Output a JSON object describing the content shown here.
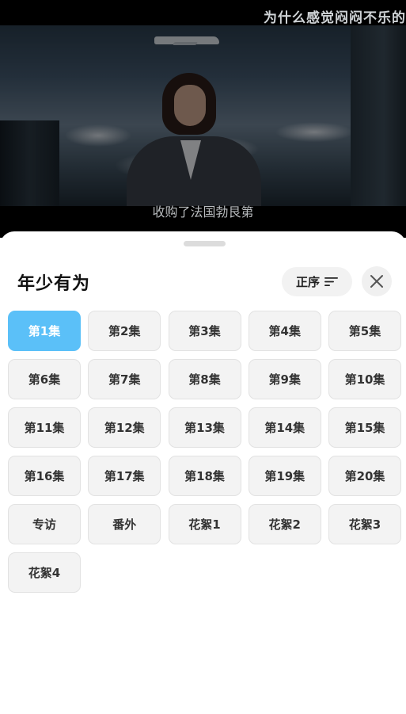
{
  "video": {
    "top_title": "为什么感觉闷闷不乐的",
    "subtitle": "收购了法国勃艮第"
  },
  "sheet": {
    "title": "年少有为",
    "sort_label": "正序",
    "sort_icon": "sort-lines-icon",
    "close_icon": "close-icon"
  },
  "episodes": [
    {
      "label": "第1集",
      "selected": true
    },
    {
      "label": "第2集",
      "selected": false
    },
    {
      "label": "第3集",
      "selected": false
    },
    {
      "label": "第4集",
      "selected": false
    },
    {
      "label": "第5集",
      "selected": false
    },
    {
      "label": "第6集",
      "selected": false
    },
    {
      "label": "第7集",
      "selected": false
    },
    {
      "label": "第8集",
      "selected": false
    },
    {
      "label": "第9集",
      "selected": false
    },
    {
      "label": "第10集",
      "selected": false
    },
    {
      "label": "第11集",
      "selected": false
    },
    {
      "label": "第12集",
      "selected": false
    },
    {
      "label": "第13集",
      "selected": false
    },
    {
      "label": "第14集",
      "selected": false
    },
    {
      "label": "第15集",
      "selected": false
    },
    {
      "label": "第16集",
      "selected": false
    },
    {
      "label": "第17集",
      "selected": false
    },
    {
      "label": "第18集",
      "selected": false
    },
    {
      "label": "第19集",
      "selected": false
    },
    {
      "label": "第20集",
      "selected": false
    },
    {
      "label": "专访",
      "selected": false
    },
    {
      "label": "番外",
      "selected": false
    },
    {
      "label": "花絮1",
      "selected": false
    },
    {
      "label": "花絮2",
      "selected": false
    },
    {
      "label": "花絮3",
      "selected": false
    },
    {
      "label": "花絮4",
      "selected": false
    }
  ],
  "colors": {
    "selected": "#5bc0f8",
    "button_bg": "#f3f3f3"
  }
}
